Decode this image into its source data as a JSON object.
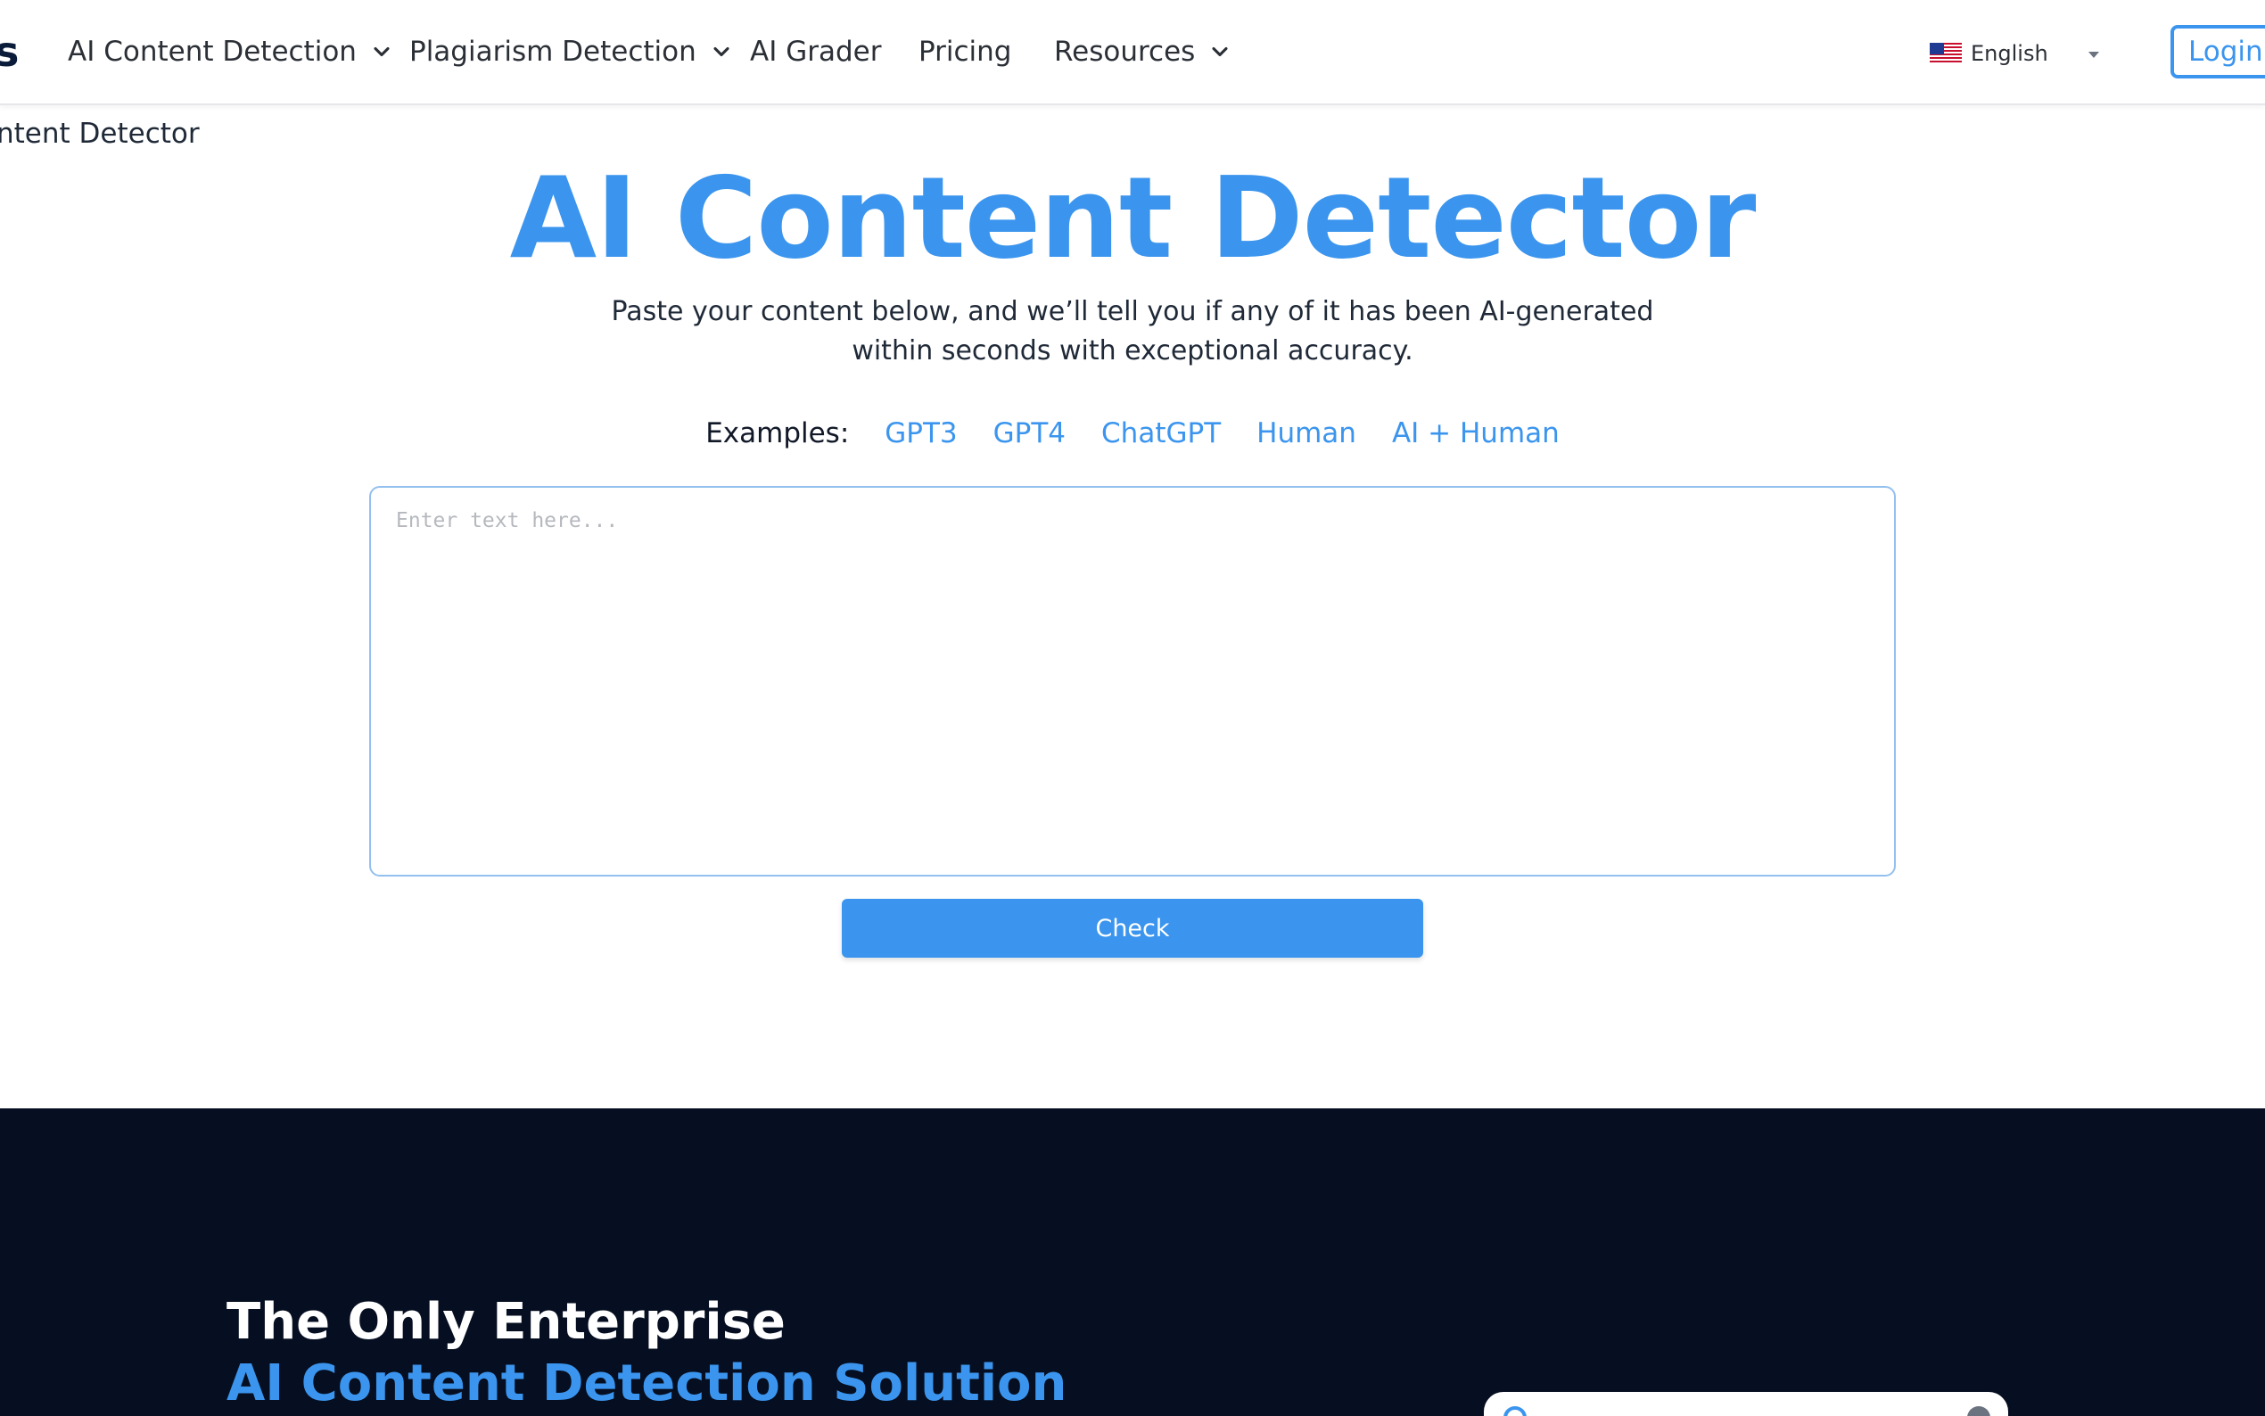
{
  "nav": {
    "logo_fragment": "s",
    "items": [
      {
        "label": "AI Content Detection",
        "has_dropdown": true
      },
      {
        "label": "Plagiarism Detection",
        "has_dropdown": true
      },
      {
        "label": "AI Grader",
        "has_dropdown": false
      },
      {
        "label": "Pricing",
        "has_dropdown": false
      },
      {
        "label": "Resources",
        "has_dropdown": true
      }
    ],
    "language": {
      "label": "English",
      "flag_icon": "us-flag-icon"
    },
    "login_label": "Login"
  },
  "breadcrumb": {
    "current": "ntent Detector"
  },
  "hero": {
    "title": "AI Content Detector",
    "subtitle_line1": "Paste your content below, and we’ll tell you if any of it has been AI-generated",
    "subtitle_line2": "within seconds with exceptional accuracy.",
    "examples_label": "Examples:",
    "examples": [
      "GPT3",
      "GPT4",
      "ChatGPT",
      "Human",
      "AI + Human"
    ],
    "input_placeholder": "Enter text here...",
    "input_value": "",
    "check_label": "Check"
  },
  "enterprise": {
    "heading_line1": "The Only Enterprise",
    "heading_line2": "AI Content Detection Solution"
  },
  "colors": {
    "accent": "#3b95ee",
    "dark_bg": "#060f21",
    "text": "#1f2937"
  }
}
